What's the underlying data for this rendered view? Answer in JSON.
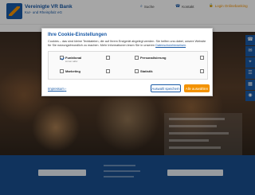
{
  "header": {
    "bank_name": "Vereinigte VR Bank",
    "bank_sub": "Kur- und Rheinpfalz eG",
    "links": [
      {
        "label": "Suche",
        "icon": "search-icon"
      },
      {
        "label": "Kontakt",
        "icon": "phone-icon"
      }
    ],
    "login_label": "Login Onlinebanking"
  },
  "dialog": {
    "title": "Ihre Cookie-Einstellungen",
    "text": "Cookies – das sind kleine Textdateien, die auf Ihrem Endgerät abgelegt werden. Sie helfen uns dabei, unsere Website für Sie nutzungsfreundlich zu machen. Mehr Informationen lesen Sie in unseren",
    "privacy_link": "Datenschutzhinweisen",
    "categories": [
      {
        "label": "Funktional",
        "sub": "immer aktiv",
        "checked": true
      },
      {
        "label": "Personalisierung",
        "checked": false
      },
      {
        "label": "Marketing",
        "checked": false
      },
      {
        "label": "Statistik",
        "checked": false
      }
    ],
    "imprint_link": "Impressum",
    "save_label": "Auswahl speichern",
    "accept_label": "Alle auswählen"
  },
  "colors": {
    "brand_blue": "#1a5aa6",
    "accent_orange": "#f39200"
  }
}
